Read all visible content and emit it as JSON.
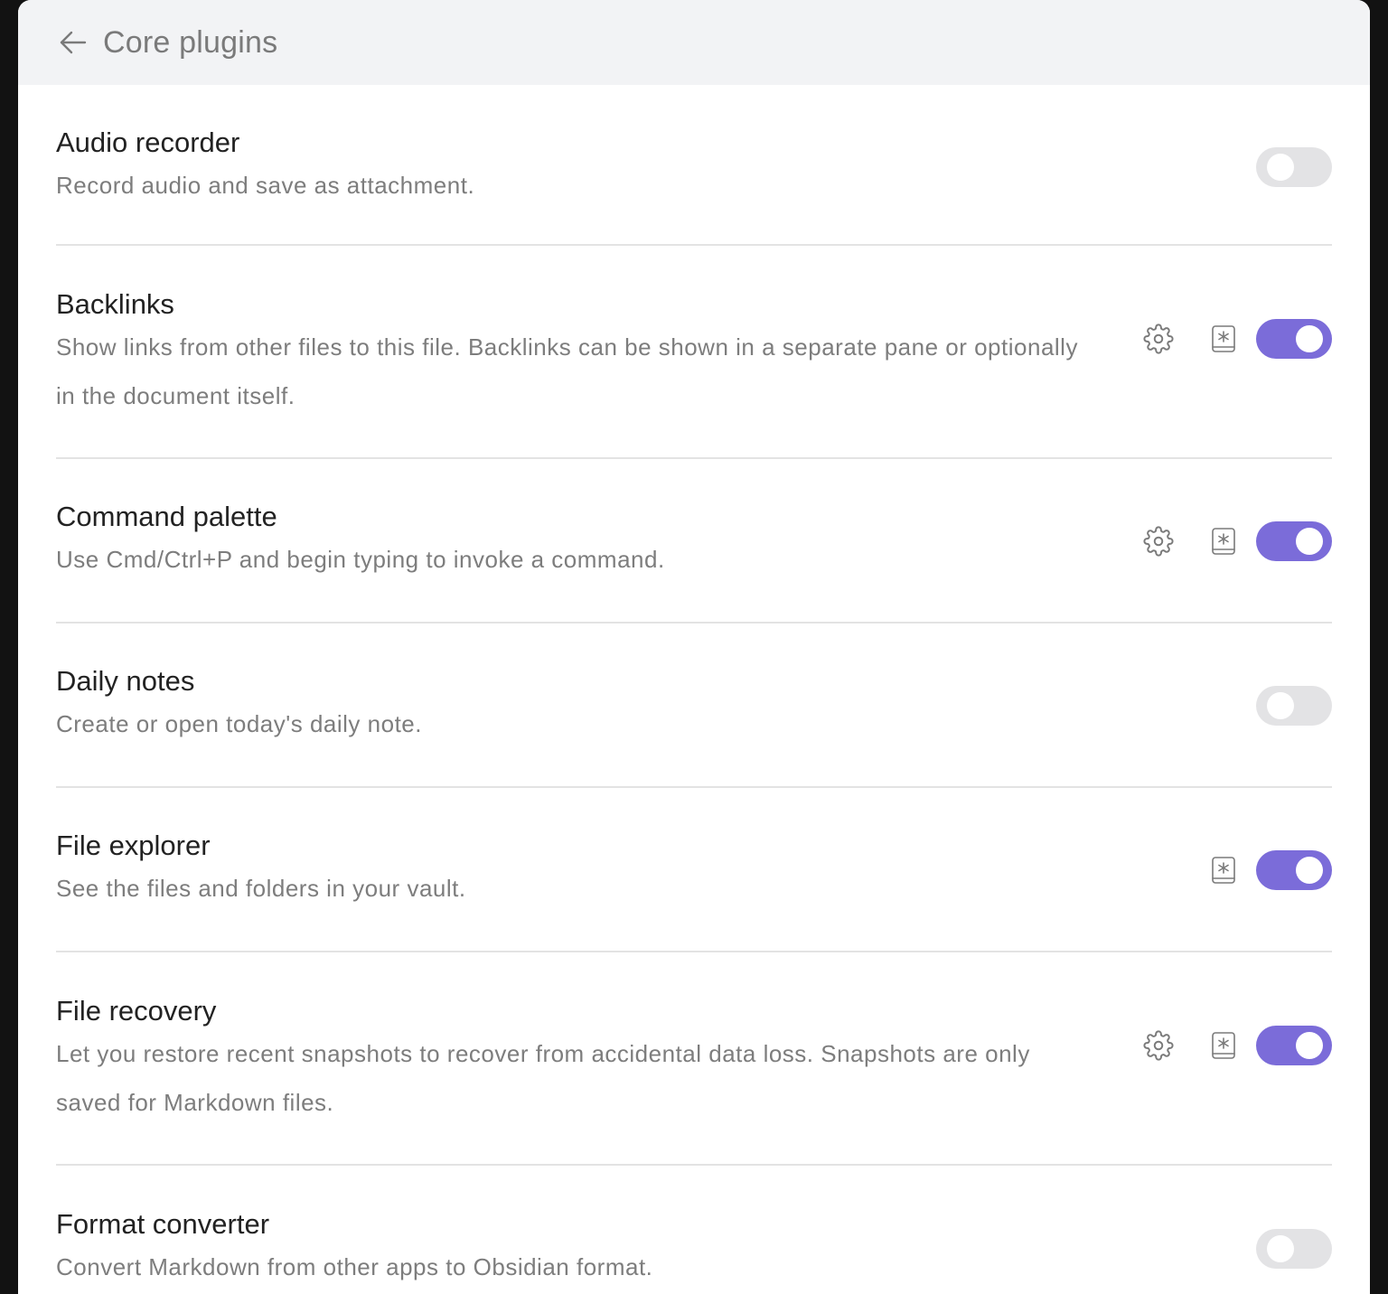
{
  "header": {
    "title": "Core plugins",
    "back_icon": "arrow-left-icon"
  },
  "colors": {
    "accent": "#7b6cd9",
    "toggle_off": "#e3e3e5",
    "header_bg": "#f2f3f5"
  },
  "plugins": [
    {
      "name": "Audio recorder",
      "description": "Record audio and save as attachment.",
      "enabled": false,
      "has_settings": false,
      "has_hotkeys": false
    },
    {
      "name": "Backlinks",
      "description": "Show links from other files to this file. Backlinks can be shown in a separate pane or optionally in the document itself.",
      "enabled": true,
      "has_settings": true,
      "has_hotkeys": true
    },
    {
      "name": "Command palette",
      "description": "Use Cmd/Ctrl+P and begin typing to invoke a command.",
      "enabled": true,
      "has_settings": true,
      "has_hotkeys": true
    },
    {
      "name": "Daily notes",
      "description": "Create or open today's daily note.",
      "enabled": false,
      "has_settings": false,
      "has_hotkeys": false
    },
    {
      "name": "File explorer",
      "description": "See the files and folders in your vault.",
      "enabled": true,
      "has_settings": false,
      "has_hotkeys": true
    },
    {
      "name": "File recovery",
      "description": "Let you restore recent snapshots to recover from accidental data loss. Snapshots are only saved for Markdown files.",
      "enabled": true,
      "has_settings": true,
      "has_hotkeys": true
    },
    {
      "name": "Format converter",
      "description": "Convert Markdown from other apps to Obsidian format.",
      "enabled": false,
      "has_settings": false,
      "has_hotkeys": false
    }
  ]
}
